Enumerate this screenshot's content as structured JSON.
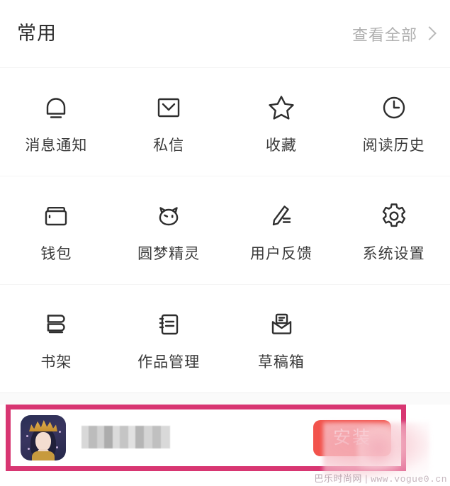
{
  "header": {
    "title": "常用",
    "view_all_label": "查看全部",
    "chevron_icon": "chevron-right-icon"
  },
  "grid": {
    "rows": [
      [
        {
          "label": "消息通知",
          "icon": "bell-icon"
        },
        {
          "label": "私信",
          "icon": "envelope-icon"
        },
        {
          "label": "收藏",
          "icon": "star-icon"
        },
        {
          "label": "阅读历史",
          "icon": "clock-icon"
        }
      ],
      [
        {
          "label": "钱包",
          "icon": "wallet-icon"
        },
        {
          "label": "圆梦精灵",
          "icon": "cat-face-icon"
        },
        {
          "label": "用户反馈",
          "icon": "pencil-icon"
        },
        {
          "label": "系统设置",
          "icon": "gear-icon"
        }
      ],
      [
        {
          "label": "书架",
          "icon": "bookshelf-icon"
        },
        {
          "label": "作品管理",
          "icon": "notebook-icon"
        },
        {
          "label": "草稿箱",
          "icon": "open-envelope-icon"
        },
        {
          "label": "",
          "icon": ""
        }
      ]
    ]
  },
  "ad": {
    "app_icon_name": "game-app-icon",
    "title_text": "",
    "title_state": "blurred",
    "install_label": "安装",
    "highlight_color": "#d83672",
    "install_button_color": "#f2534c"
  },
  "watermark": {
    "site_name": "巴乐时尚网",
    "separator": "|",
    "url": "www.vogue0.cn"
  }
}
